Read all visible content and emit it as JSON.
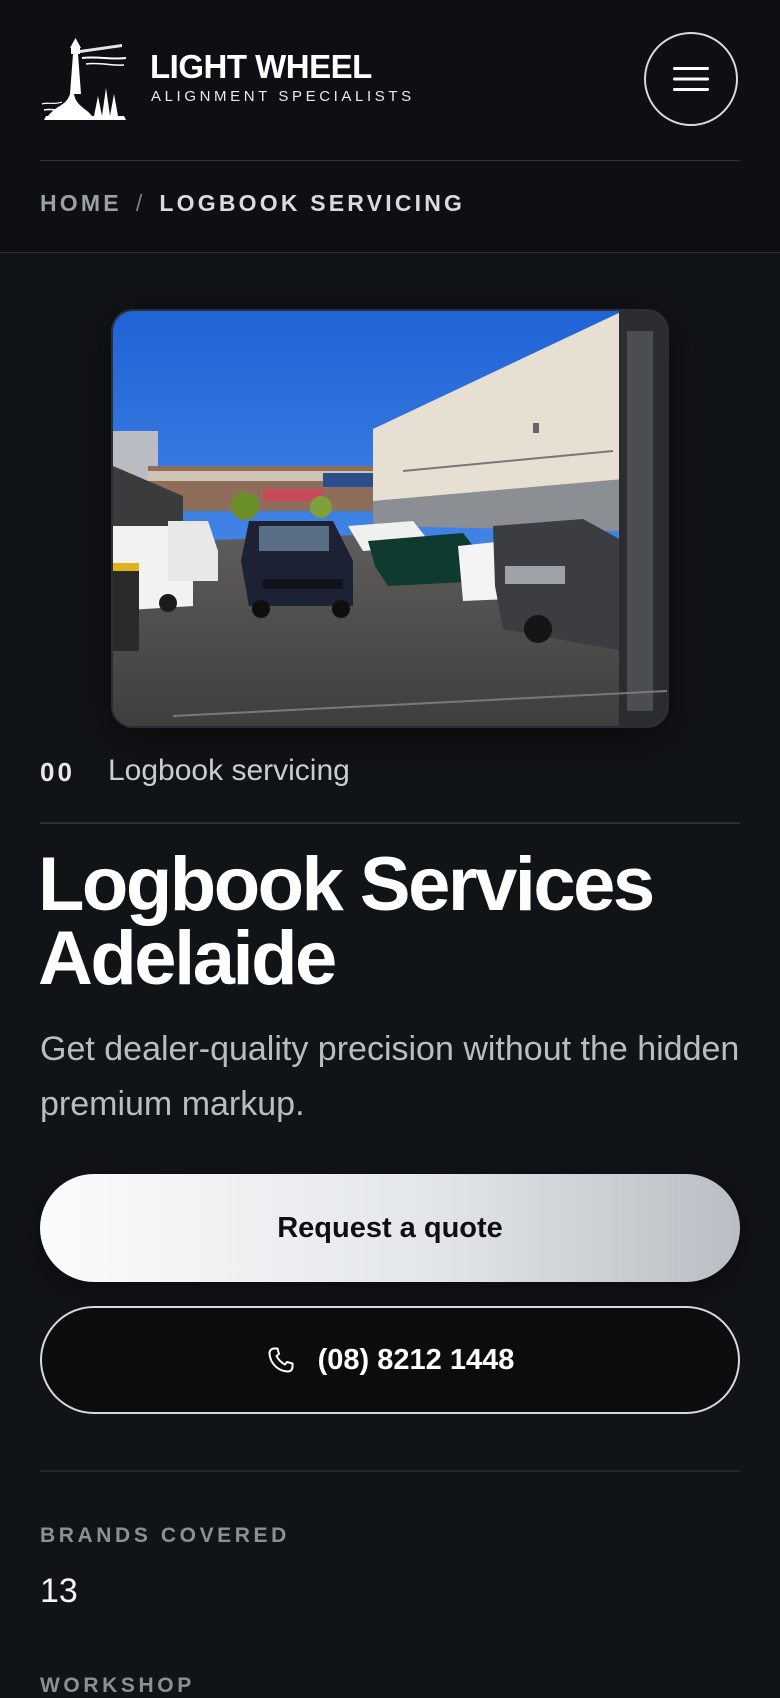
{
  "brand": {
    "name": "LIGHT WHEEL",
    "tagline": "ALIGNMENT SPECIALISTS"
  },
  "icons": {
    "logo": "lighthouse-logo-icon",
    "menu": "hamburger-menu-icon",
    "phone": "phone-icon"
  },
  "breadcrumb": {
    "home": "HOME",
    "separator": "/",
    "current": "LOGBOOK SERVICING"
  },
  "service": {
    "index": "00",
    "label": "Logbook servicing"
  },
  "hero": {
    "title": "Logbook Services Adelaide",
    "subtitle": "Get dealer-quality precision without the hidden premium markup."
  },
  "actions": {
    "quote_label": "Request a quote",
    "phone_label": "(08) 8212 1448"
  },
  "stats": [
    {
      "label": "BRANDS COVERED",
      "value": "13"
    },
    {
      "label": "WORKSHOP"
    }
  ],
  "colors": {
    "background": "#111417",
    "header": "#0d0f12",
    "accent_button": "#f2f3f5"
  }
}
